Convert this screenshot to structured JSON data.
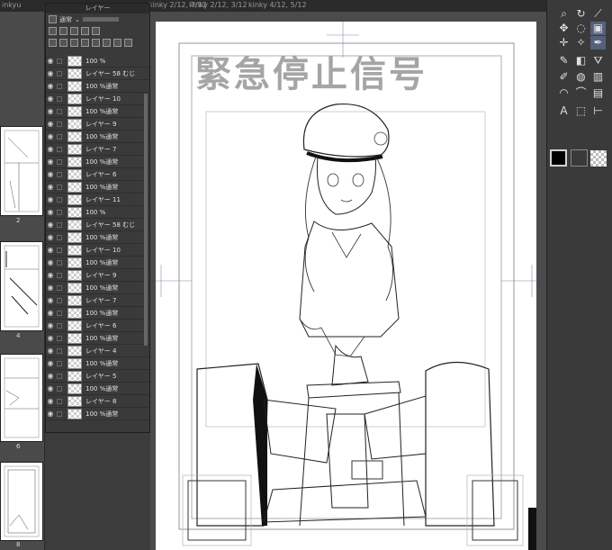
{
  "tabs": [
    "inkyu",
    "kinky 2/12, 7/12",
    "kinky 2/12, 3/12",
    "kinky 4/12, 5/12"
  ],
  "page_list": {
    "items": [
      {
        "label": "2"
      },
      {
        "label": "4"
      },
      {
        "label": "6"
      },
      {
        "label": "8"
      }
    ]
  },
  "layer_panel": {
    "title": "レイヤー",
    "blend_mode": "通常",
    "rows": [
      {
        "opacity": "100 %",
        "name": ""
      },
      {
        "opacity": "",
        "name": "レイヤー 58 むじ"
      },
      {
        "opacity": "100 %通常",
        "name": ""
      },
      {
        "opacity": "",
        "name": "レイヤー 10"
      },
      {
        "opacity": "100 %通常",
        "name": ""
      },
      {
        "opacity": "",
        "name": "レイヤー 9"
      },
      {
        "opacity": "100 %通常",
        "name": ""
      },
      {
        "opacity": "",
        "name": "レイヤー 7"
      },
      {
        "opacity": "100 %通常",
        "name": ""
      },
      {
        "opacity": "",
        "name": "レイヤー 6"
      },
      {
        "opacity": "100 %通常",
        "name": ""
      },
      {
        "opacity": "",
        "name": "レイヤー 11"
      },
      {
        "opacity": "100 %",
        "name": ""
      },
      {
        "opacity": "",
        "name": "レイヤー 58 むじ"
      },
      {
        "opacity": "100 %通常",
        "name": ""
      },
      {
        "opacity": "",
        "name": "レイヤー 10"
      },
      {
        "opacity": "100 %通常",
        "name": ""
      },
      {
        "opacity": "",
        "name": "レイヤー 9"
      },
      {
        "opacity": "100 %通常",
        "name": ""
      },
      {
        "opacity": "",
        "name": "レイヤー 7"
      },
      {
        "opacity": "100 %通常",
        "name": ""
      },
      {
        "opacity": "",
        "name": "レイヤー 6"
      },
      {
        "opacity": "100 %通常",
        "name": ""
      },
      {
        "opacity": "",
        "name": "レイヤー 4"
      },
      {
        "opacity": "100 %通常",
        "name": ""
      },
      {
        "opacity": "",
        "name": "レイヤー 5"
      },
      {
        "opacity": "100 %通常",
        "name": ""
      },
      {
        "opacity": "",
        "name": "レイヤー 8"
      },
      {
        "opacity": "100 %通常",
        "name": ""
      }
    ]
  },
  "canvas": {
    "title_text": "緊急停止信号"
  },
  "tools": {
    "icons": [
      "zoom-icon",
      "rotate-icon",
      "eyedropper-icon",
      "move-icon",
      "lasso-icon",
      "auto-select-icon",
      "move-layer-icon",
      "sparkle-icon",
      "pen-icon",
      "pencil-icon",
      "eraser-icon",
      "fill-icon",
      "brush-icon",
      "blend-icon",
      "gradient-icon",
      "figure-icon",
      "curve-icon",
      "frame-icon",
      "text-icon",
      "select-icon",
      "ruler-icon"
    ],
    "text_tool_label": "A"
  },
  "colors": {
    "main": "#000000",
    "accent": "#55607a"
  }
}
